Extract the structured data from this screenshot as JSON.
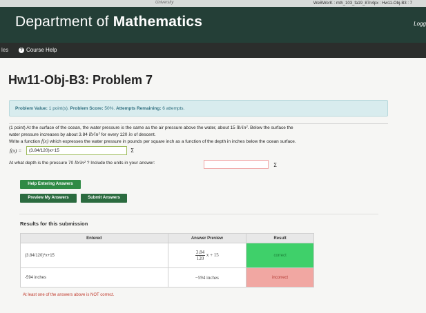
{
  "window": {
    "title": "WeBWorK : mth_103_fa19_87n4px : Hw11-Obj-B3 : 7",
    "university_fragment": "University"
  },
  "header": {
    "dept_prefix": "Department of ",
    "dept_bold": "Mathematics",
    "logout": "Logg"
  },
  "nav": {
    "left_fragment": "les",
    "course_help": "Course Help"
  },
  "page_title": "Hw11-Obj-B3: Problem 7",
  "score": {
    "value_label": "Problem Value:",
    "value": "1 point(s).",
    "score_label": "Problem Score:",
    "score": "50%.",
    "attempts_label": "Attempts Remaining:",
    "attempts": "6 attempts."
  },
  "problem": {
    "line1_a": "(1 point) At the surface of the ocean, the water pressure is the same as the air pressure above the water, about 15",
    "unit1": "lb/in²",
    "line1_b": ". Below the surface the",
    "line2_a": "water pressure increases by about 3.84",
    "unit2": "lb/in²",
    "line2_b": "for every 120",
    "unit3": "in",
    "line2_c": "of descent.",
    "line3_a": "Write a function",
    "fx": "f(x)",
    "line3_b": "which expresses the water pressure in pounds per square inch as a function of the depth in inches below the ocean surface.",
    "f_label": "f(x) =",
    "answer1_value": "(3.84/120)x+15",
    "q2_a": "At what depth is the pressure 70",
    "unit4": "lb/in²",
    "q2_b": "? Include the units in your answer:",
    "answer2_value": ""
  },
  "buttons": {
    "help_entering": "Help Entering Answers",
    "preview": "Preview My Answers",
    "submit": "Submit Answers"
  },
  "results": {
    "heading": "Results for this submission",
    "columns": [
      "Entered",
      "Answer Preview",
      "Result"
    ],
    "rows": [
      {
        "entered": "(3.84/120)*x+15",
        "preview_num": "3.84",
        "preview_den": "120",
        "preview_rest": "x + 15",
        "result": "correct"
      },
      {
        "entered": "-594 inches",
        "preview": "−594 inches",
        "result": "incorrect"
      }
    ],
    "warning": "At least one of the answers above is NOT correct."
  },
  "colors": {
    "header_bg": "#243f37",
    "nav_bg": "#2b2e2c",
    "correct": "#3fd06a",
    "incorrect": "#f1a7a2",
    "button": "#2b6b3f"
  }
}
